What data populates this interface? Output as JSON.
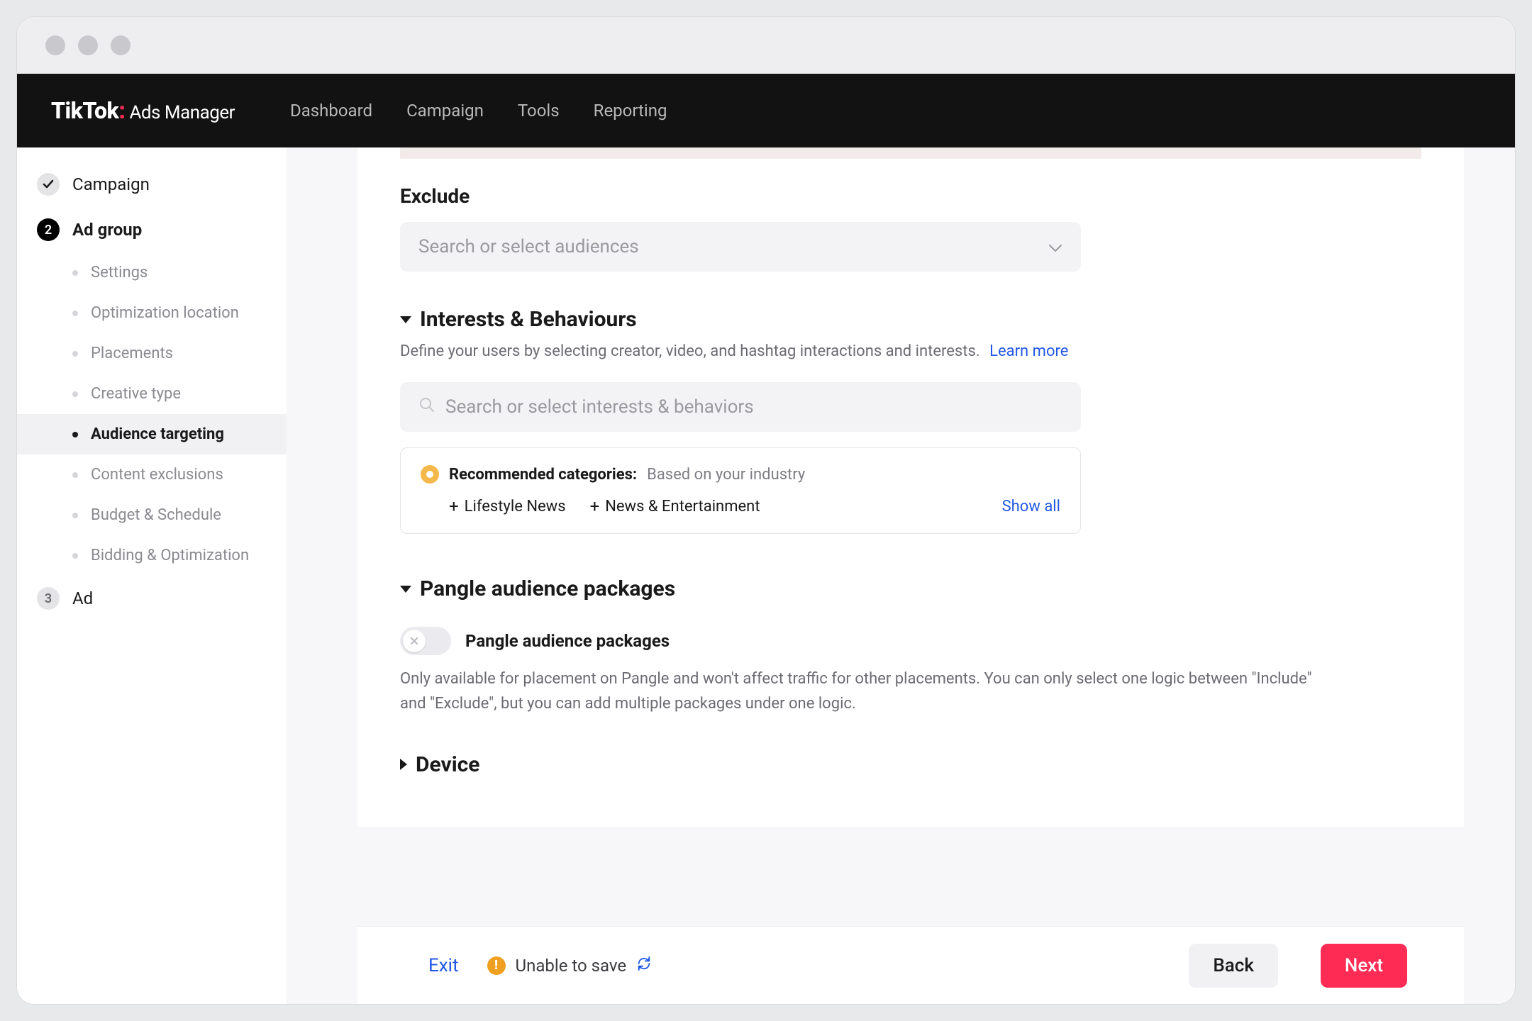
{
  "brand": {
    "name": "TikTok",
    "suffix": "Ads Manager"
  },
  "nav": {
    "dashboard": "Dashboard",
    "campaign": "Campaign",
    "tools": "Tools",
    "reporting": "Reporting"
  },
  "sidebar": {
    "step1": "Campaign",
    "step2": "Ad group",
    "step2_num": "2",
    "step3": "Ad",
    "step3_num": "3",
    "items": [
      "Settings",
      "Optimization location",
      "Placements",
      "Creative type",
      "Audience targeting",
      "Content exclusions",
      "Budget & Schedule",
      "Bidding & Optimization"
    ]
  },
  "exclude": {
    "label": "Exclude",
    "placeholder": "Search or select audiences"
  },
  "interests": {
    "title": "Interests & Behaviours",
    "desc": "Define your users by selecting creator, video, and hashtag interactions and interests.",
    "learn": "Learn more",
    "search_placeholder": "Search or select interests & behaviors",
    "reco_label": "Recommended categories:",
    "reco_sub": "Based on your industry",
    "chips": [
      "Lifestyle News",
      "News & Entertainment"
    ],
    "show_all": "Show all"
  },
  "pangle": {
    "title": "Pangle audience packages",
    "toggle_label": "Pangle audience packages",
    "desc": "Only available for placement on Pangle and won't affect traffic for other placements. You can only select one logic between \"Include\" and \"Exclude\", but you can add multiple packages under one logic."
  },
  "device": {
    "title": "Device"
  },
  "footer": {
    "exit": "Exit",
    "status": "Unable to save",
    "back": "Back",
    "next": "Next"
  }
}
